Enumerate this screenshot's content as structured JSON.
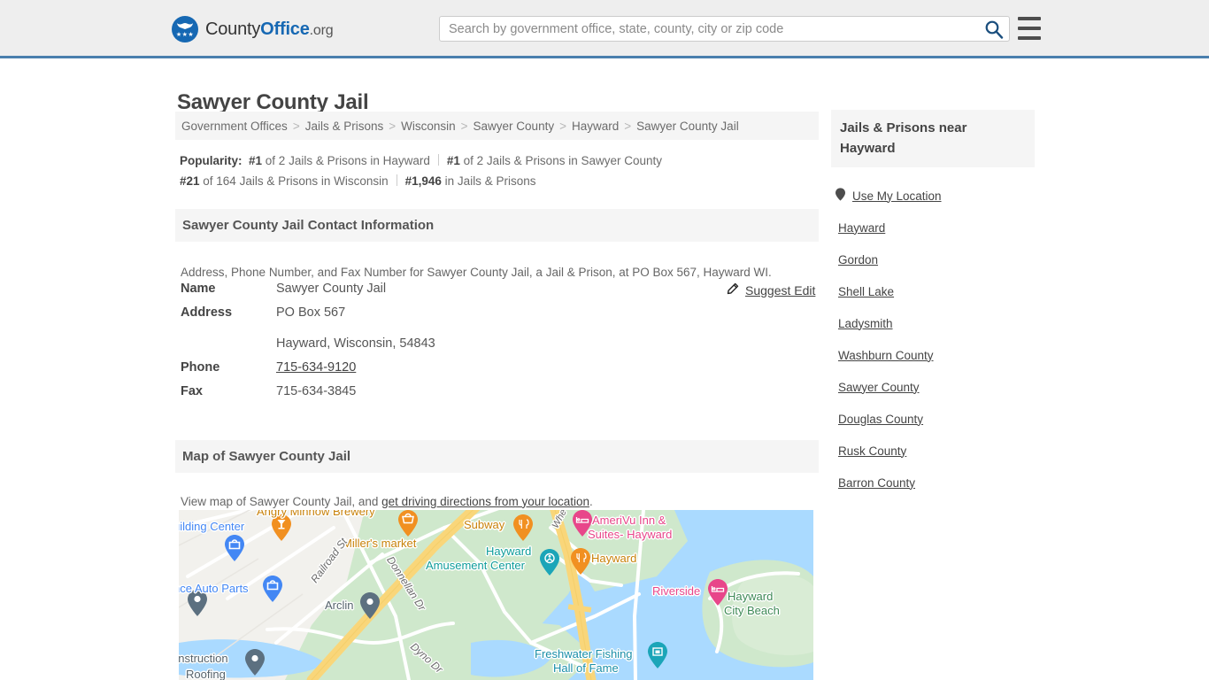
{
  "header": {
    "brand": {
      "part1": "County",
      "part2": "Office",
      "part3": ".org",
      "icon": "eagle-seal-logo",
      "stars": "★★★"
    },
    "search": {
      "placeholder": "Search by government office, state, county, city or zip code",
      "value": "",
      "search_icon": "search-icon"
    },
    "menu_icon": "hamburger-menu-icon",
    "accent_color": "#4a7fad"
  },
  "page": {
    "title": "Sawyer County Jail"
  },
  "breadcrumb": {
    "separator": ">",
    "items": [
      {
        "label": "Government Offices",
        "link": true
      },
      {
        "label": "Jails & Prisons",
        "link": true
      },
      {
        "label": "Wisconsin",
        "link": true
      },
      {
        "label": "Sawyer County",
        "link": true
      },
      {
        "label": "Hayward",
        "link": true
      },
      {
        "label": "Sawyer County Jail",
        "link": false
      }
    ]
  },
  "popularity": {
    "label": "Popularity:",
    "entries": [
      {
        "rank": "#1",
        "rest": " of 2 Jails & Prisons in Hayward"
      },
      {
        "rank": "#1",
        "rest": " of 2 Jails & Prisons in Sawyer County"
      },
      {
        "rank": "#21",
        "rest": " of 164 Jails & Prisons in Wisconsin"
      },
      {
        "rank": "#1,946",
        "rest": " in Jails & Prisons"
      }
    ]
  },
  "contact": {
    "heading": "Sawyer County Jail Contact Information",
    "description": "Address, Phone Number, and Fax Number for Sawyer County Jail, a Jail & Prison, at PO Box 567, Hayward WI.",
    "rows": [
      {
        "label": "Name",
        "value": "Sawyer County Jail",
        "link": false
      },
      {
        "label": "Address",
        "value": "PO Box 567",
        "value2": "Hayward, Wisconsin, 54843",
        "link": false
      },
      {
        "label": "Phone",
        "value": "715-634-9120",
        "link": true
      },
      {
        "label": "Fax",
        "value": "715-634-3845",
        "link": false
      }
    ],
    "suggest_edit": {
      "label": "Suggest Edit",
      "icon": "edit-pencil-icon"
    }
  },
  "map_section": {
    "heading": "Map of Sawyer County Jail",
    "description_prefix": "View map of Sawyer County Jail, and ",
    "description_link": "get driving directions from your location",
    "description_suffix": "."
  },
  "map": {
    "labels": [
      {
        "text": "Angry Minnow Brewery",
        "color": "#c8820a"
      },
      {
        "text": "uilding Center",
        "color": "#4387f4"
      },
      {
        "text": "Miller's market",
        "color": "#c8820a"
      },
      {
        "text": "nce Auto Parts",
        "color": "#4387f4"
      },
      {
        "text": "Railroad St",
        "color": "#6b6b6b"
      },
      {
        "text": "Donnellan Dr",
        "color": "#6b6b6b"
      },
      {
        "text": "Dyno Dr",
        "color": "#6b6b6b"
      },
      {
        "text": "Arclin",
        "color": "#55636c"
      },
      {
        "text": "onstruction",
        "color": "#55636c"
      },
      {
        "text": "Roofing",
        "color": "#55636c"
      },
      {
        "text": "Subway",
        "color": "#c8820a"
      },
      {
        "text": "Whe",
        "color": "#6b6b6b"
      },
      {
        "text": "AmeriVu Inn &",
        "color": "#e8468a"
      },
      {
        "text": "Suites- Hayward",
        "color": "#e8468a"
      },
      {
        "text": "Hayward",
        "color": "#0f9d9a"
      },
      {
        "text": "Amusement Center",
        "color": "#0f9d9a"
      },
      {
        "text": "Hayward",
        "color": "#c8820a"
      },
      {
        "text": "Riverside",
        "color": "#e8468a"
      },
      {
        "text": "Hayward",
        "color": "#3e8a56"
      },
      {
        "text": "City Beach",
        "color": "#3e8a56"
      },
      {
        "text": "Freshwater Fishing",
        "color": "#1a8fa8"
      },
      {
        "text": "Hall of Fame",
        "color": "#1a8fa8"
      }
    ],
    "colors": {
      "water": "#aadaff",
      "park": "#cfe8cc",
      "land": "#f2f1ed",
      "highway": "#f9d67a",
      "road": "#ffffff",
      "pin_orange": "#f19021",
      "pin_blue": "#4387f4",
      "pin_teal": "#1ba5b8",
      "pin_pink": "#e8468a",
      "pin_gray": "#5c7080"
    }
  },
  "sidebar": {
    "heading": "Jails & Prisons near Hayward",
    "location": {
      "label": "Use My Location",
      "icon": "map-pin-icon"
    },
    "items": [
      {
        "label": "Hayward"
      },
      {
        "label": "Gordon"
      },
      {
        "label": "Shell Lake"
      },
      {
        "label": "Ladysmith"
      },
      {
        "label": "Washburn County"
      },
      {
        "label": "Sawyer County"
      },
      {
        "label": "Douglas County"
      },
      {
        "label": "Rusk County"
      },
      {
        "label": "Barron County"
      }
    ]
  }
}
